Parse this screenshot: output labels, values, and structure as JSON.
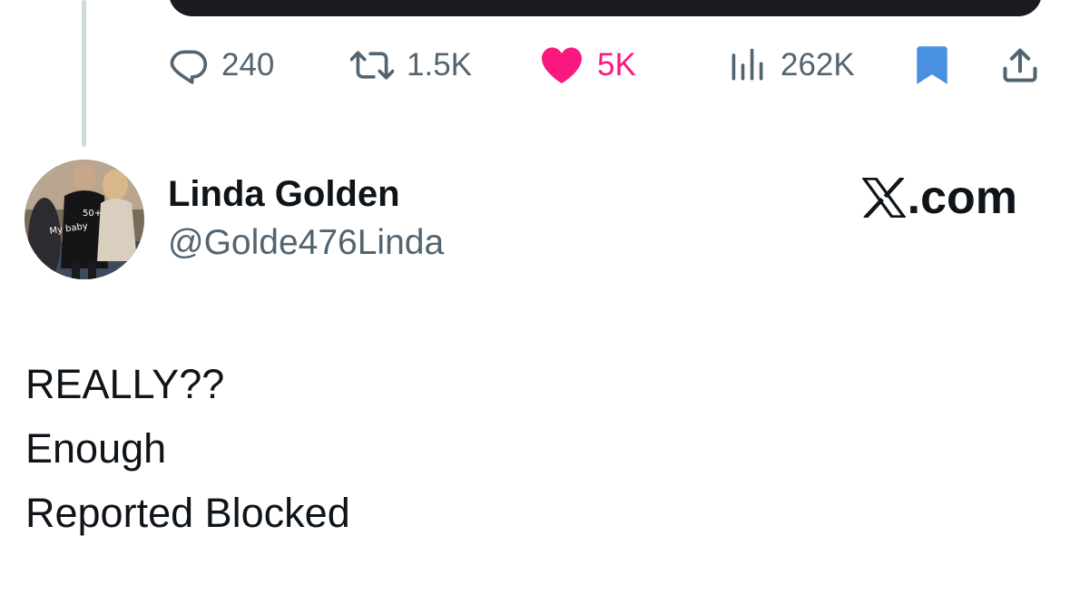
{
  "actions": {
    "replies": "240",
    "reposts": "1.5K",
    "likes": "5K",
    "views": "262K"
  },
  "colors": {
    "text_primary": "#0f1419",
    "text_secondary": "#536471",
    "like_active": "#f91880",
    "bookmark_active": "#4a90e2",
    "thread_line": "#cfd9de"
  },
  "icons": [
    "reply-icon",
    "repost-icon",
    "like-icon",
    "views-icon",
    "bookmark-icon",
    "share-icon",
    "x-logo-icon"
  ],
  "author": {
    "display_name": "Linda Golden",
    "handle": "@Golde476Linda",
    "avatar_text_1": "50+",
    "avatar_text_2": "My baby"
  },
  "brand": {
    "suffix": ".com"
  },
  "tweet": {
    "lines": [
      "REALLY??",
      "Enough",
      "Reported Blocked"
    ]
  }
}
